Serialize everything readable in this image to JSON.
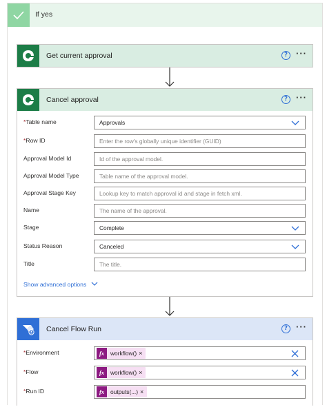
{
  "branch": {
    "label": "If yes"
  },
  "get_approval": {
    "title": "Get current approval"
  },
  "cancel_approval": {
    "title": "Cancel approval",
    "fields": [
      {
        "label": "Table name",
        "required": true,
        "value": "Approvals",
        "placeholder": "",
        "type": "dropdown"
      },
      {
        "label": "Row ID",
        "required": true,
        "value": "",
        "placeholder": "Enter the row's globally unique identifier (GUID)",
        "type": "text"
      },
      {
        "label": "Approval Model Id",
        "required": false,
        "value": "",
        "placeholder": "Id of the approval model.",
        "type": "text"
      },
      {
        "label": "Approval Model Type",
        "required": false,
        "value": "",
        "placeholder": "Table name of the approval model.",
        "type": "text"
      },
      {
        "label": "Approval Stage Key",
        "required": false,
        "value": "",
        "placeholder": "Lookup key to match approval id and stage in fetch xml.",
        "type": "text"
      },
      {
        "label": "Name",
        "required": false,
        "value": "",
        "placeholder": "The name of the approval.",
        "type": "text"
      },
      {
        "label": "Stage",
        "required": false,
        "value": "Complete",
        "placeholder": "",
        "type": "dropdown"
      },
      {
        "label": "Status Reason",
        "required": false,
        "value": "Canceled",
        "placeholder": "",
        "type": "dropdown"
      },
      {
        "label": "Title",
        "required": false,
        "value": "",
        "placeholder": "The title.",
        "type": "text"
      }
    ],
    "advanced_link": "Show advanced options"
  },
  "cancel_flow_run": {
    "title": "Cancel Flow Run",
    "fields": [
      {
        "label": "Environment",
        "required": true,
        "token": "workflow()",
        "clearable": true
      },
      {
        "label": "Flow",
        "required": true,
        "token": "workflow()",
        "clearable": true
      },
      {
        "label": "Run ID",
        "required": true,
        "token": "outputs(...)",
        "clearable": false
      }
    ]
  },
  "colors": {
    "dataverse_green": "#1c7d47",
    "flow_blue": "#2f6fd6",
    "expression_purple": "#8d1a82",
    "branch_green": "#8fd6a3"
  },
  "icons": {
    "branch": "checkmark-icon",
    "dataverse": "dataverse-icon",
    "flow": "power-automate-icon",
    "help": "help-icon",
    "more": "more-options-icon",
    "dropdown": "chevron-down-icon",
    "clear": "close-icon",
    "expression": "fx-icon"
  }
}
